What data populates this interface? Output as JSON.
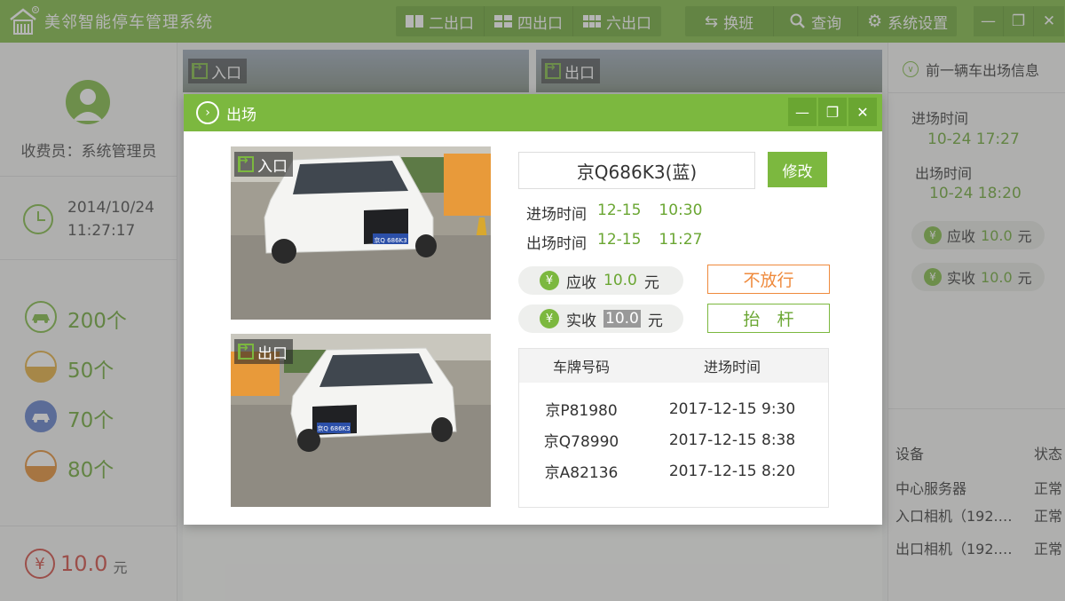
{
  "app": {
    "title": "美邻智能停车管理系统",
    "logo_mark": "R"
  },
  "toolbar": {
    "layout_buttons": [
      {
        "label": "二出口",
        "icon": "two-grid-icon"
      },
      {
        "label": "四出口",
        "icon": "four-grid-icon"
      },
      {
        "label": "六出口",
        "icon": "six-grid-icon"
      }
    ],
    "actions": [
      {
        "label": "换班",
        "icon": "swap-icon"
      },
      {
        "label": "查询",
        "icon": "search-icon"
      },
      {
        "label": "系统设置",
        "icon": "gear-icon"
      }
    ],
    "window": {
      "minimize": "—",
      "restore": "❐",
      "close": "✕"
    }
  },
  "sidebar": {
    "cashier": "收费员：系统管理员",
    "date": "2014/10/24",
    "time": "11:27:17",
    "stats": [
      {
        "value": "200个",
        "color": "#7cb83f"
      },
      {
        "value": "50个",
        "color": "#e3ac3a"
      },
      {
        "value": "70个",
        "color": "#5b7bc9"
      },
      {
        "value": "80个",
        "color": "#e38a2e"
      }
    ],
    "fee": {
      "symbol": "¥",
      "amount": "10.0",
      "unit": "元"
    }
  },
  "background": {
    "cam_entry": "入口",
    "cam_exit": "出口"
  },
  "right_panel": {
    "title": "前一辆车出场信息",
    "entry_label": "进场时间",
    "entry_value": "10-24   17:27",
    "exit_label": "出场时间",
    "exit_value": "10-24   18:20",
    "due": {
      "label": "应收",
      "amount": "10.0",
      "unit": "元"
    },
    "paid": {
      "label": "实收",
      "amount": "10.0",
      "unit": "元"
    },
    "devices": {
      "col_device": "设备",
      "col_status": "状态",
      "rows": [
        {
          "name": "中心服务器",
          "status": "正常"
        },
        {
          "name": "入口相机（192.1...",
          "status": "正常"
        },
        {
          "name": "出口相机（192.1...",
          "status": "正常"
        }
      ]
    }
  },
  "modal": {
    "title": "出场",
    "photo_entry_tag": "入口",
    "photo_exit_tag": "出口",
    "plate_text": "京Q686K3",
    "plate_photo_text": "京Q 686K3",
    "plate": "京Q686K3(蓝)",
    "edit_label": "修改",
    "entry_label": "进场时间",
    "entry_date": "12-15",
    "entry_time": "10:30",
    "exit_label": "出场时间",
    "exit_date": "12-15",
    "exit_time": "11:27",
    "due": {
      "label": "应收",
      "amount": "10.0",
      "unit": "元"
    },
    "paid": {
      "label": "实收",
      "amount": "10.0",
      "unit": "元"
    },
    "deny_label": "不放行",
    "lift_label": "抬　杆",
    "deny_color": "#ef8a3c",
    "lift_color": "#7cb83f",
    "table": {
      "col_plate": "车牌号码",
      "col_time": "进场时间",
      "rows": [
        {
          "plate": "京P81980",
          "time": "2017-12-15    9:30"
        },
        {
          "plate": "京Q78990",
          "time": "2017-12-15    8:38"
        },
        {
          "plate": "京A82136",
          "time": "2017-12-15    8:20"
        }
      ]
    }
  },
  "colors": {
    "brand": "#7cb83f",
    "brand_dark": "#6aa632",
    "fee_red": "#d0463c"
  }
}
